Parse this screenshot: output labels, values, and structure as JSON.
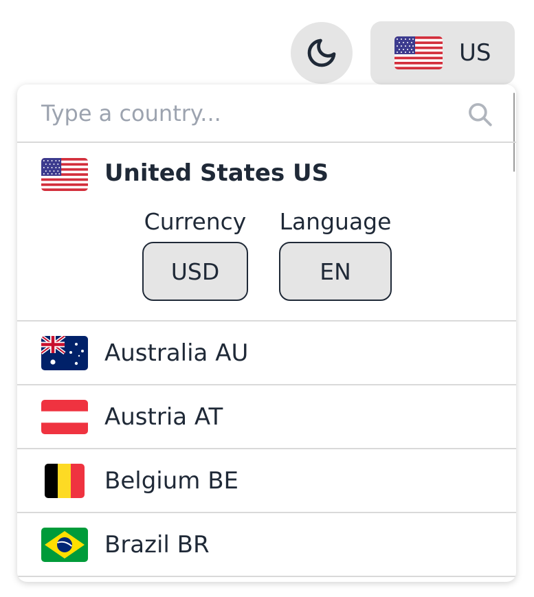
{
  "header": {
    "theme_toggle_icon": "moon-icon",
    "selected_country_code": "US",
    "selected_flag": "us-flag"
  },
  "search": {
    "placeholder": "Type a country...",
    "value": "",
    "icon": "search-icon"
  },
  "selected_country": {
    "name": "United States US",
    "flag": "us-flag",
    "currency_label": "Currency",
    "currency_value": "USD",
    "language_label": "Language",
    "language_value": "EN"
  },
  "countries": [
    {
      "name": "Australia AU",
      "flag": "au-flag"
    },
    {
      "name": "Austria AT",
      "flag": "at-flag"
    },
    {
      "name": "Belgium BE",
      "flag": "be-flag"
    },
    {
      "name": "Brazil BR",
      "flag": "br-flag"
    }
  ],
  "colors": {
    "button_bg": "#e5e5e5",
    "text": "#1f2937",
    "divider": "#d9d9d9",
    "placeholder": "#9ca3af"
  }
}
